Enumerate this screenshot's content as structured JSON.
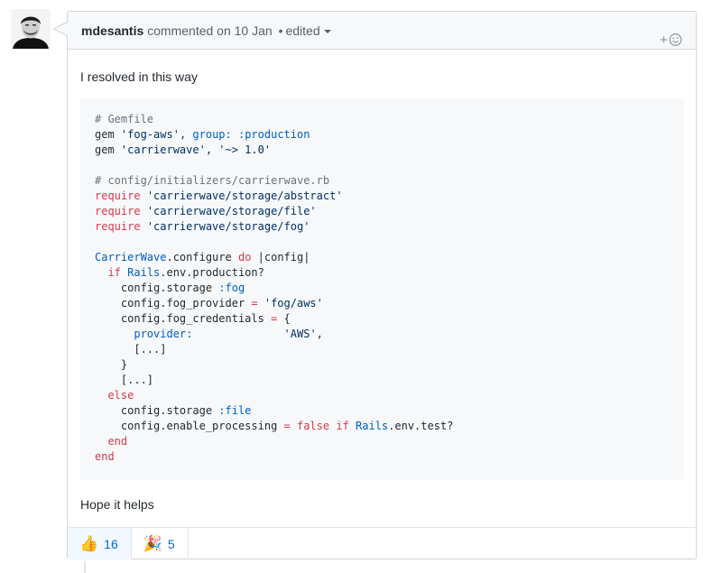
{
  "header": {
    "author": "mdesantis",
    "action": "commented on 10 Jan",
    "separator": "•",
    "edited": "edited"
  },
  "body": {
    "intro": "I resolved in this way",
    "outro": "Hope it helps"
  },
  "code_block": {
    "language": "ruby",
    "text": "# Gemfile\ngem 'fog-aws', group: :production\ngem 'carrierwave', '~> 1.0'\n\n# config/initializers/carrierwave.rb\nrequire 'carrierwave/storage/abstract'\nrequire 'carrierwave/storage/file'\nrequire 'carrierwave/storage/fog'\n\nCarrierWave.configure do |config|\n  if Rails.env.production?\n    config.storage :fog\n    config.fog_provider = 'fog/aws'\n    config.fog_credentials = {\n      provider:              'AWS',\n      [...]\n    }\n    [...]\n  else\n    config.storage :file\n    config.enable_processing = false if Rails.env.test?\n  end\nend"
  },
  "reactions": [
    {
      "icon": "thumbs-up-icon",
      "emoji": "👍",
      "count": "16"
    },
    {
      "icon": "party-popper-icon",
      "emoji": "🎉",
      "count": "5"
    }
  ],
  "colors": {
    "link": "#0366d6",
    "border": "#d1d5da",
    "header_bg": "#f6f8fa",
    "code_bg": "#f6f8fa",
    "keyword": "#d73a49",
    "constant": "#005cc5",
    "string": "#032f62",
    "comment": "#6a737d"
  }
}
